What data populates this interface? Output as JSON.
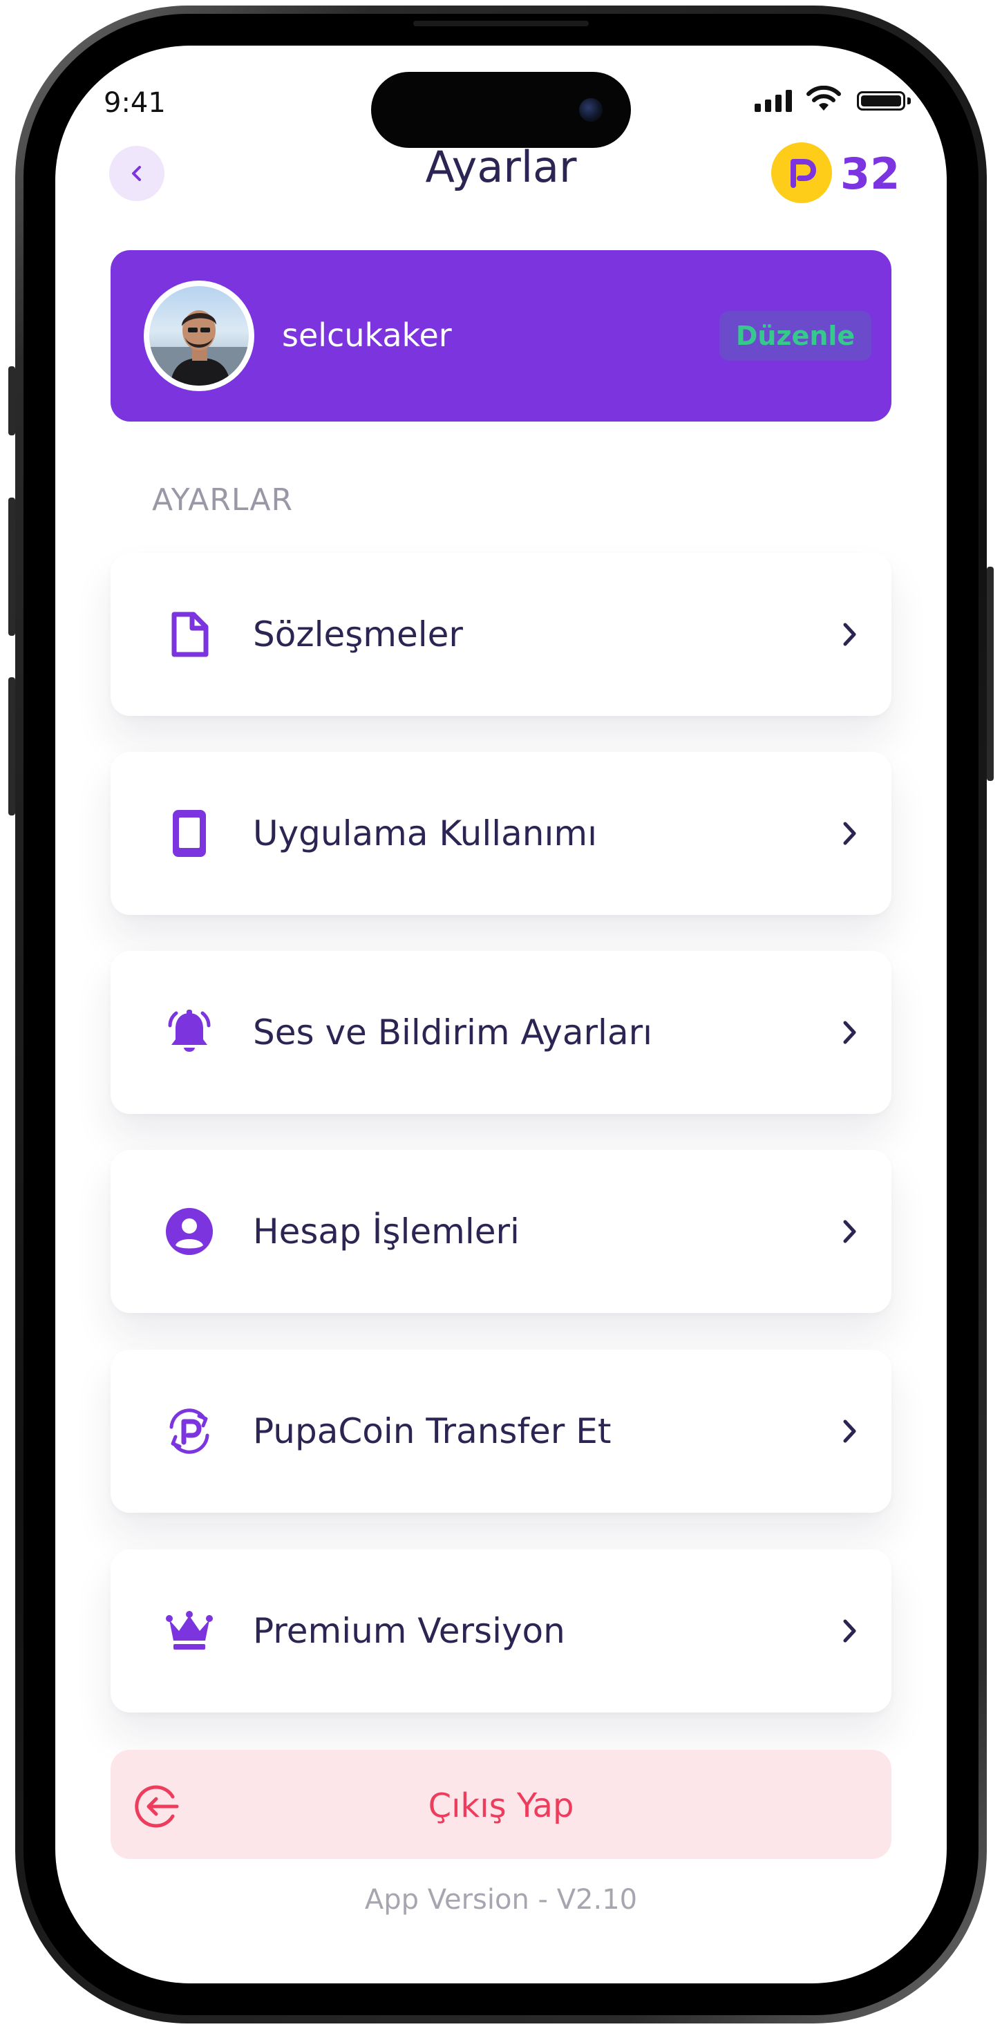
{
  "status_bar": {
    "time": "9:41"
  },
  "header": {
    "title": "Ayarlar",
    "coin_count": "32",
    "back_icon": "chevron-left-icon",
    "coin_icon": "pupacoin-icon"
  },
  "profile": {
    "username": "selcukaker",
    "edit_label": "Düzenle"
  },
  "section": {
    "label": "AYARLAR"
  },
  "menu": [
    {
      "label": "Sözleşmeler",
      "icon": "document-icon"
    },
    {
      "label": "Uygulama Kullanımı",
      "icon": "phone-icon"
    },
    {
      "label": "Ses ve Bildirim Ayarları",
      "icon": "bell-icon"
    },
    {
      "label": "Hesap İşlemleri",
      "icon": "user-circle-icon"
    },
    {
      "label": "PupaCoin Transfer Et",
      "icon": "coin-transfer-icon"
    },
    {
      "label": "Premium Versiyon",
      "icon": "crown-icon"
    }
  ],
  "logout": {
    "label": "Çıkış Yap",
    "icon": "logout-icon"
  },
  "footer": {
    "version": "App Version - V2.10"
  },
  "colors": {
    "accent": "#7c35de",
    "title": "#2c2452",
    "danger": "#ee3d5c",
    "danger_bg": "#fde6ea",
    "coin": "#fecd1a",
    "edit_text": "#35c98c"
  }
}
